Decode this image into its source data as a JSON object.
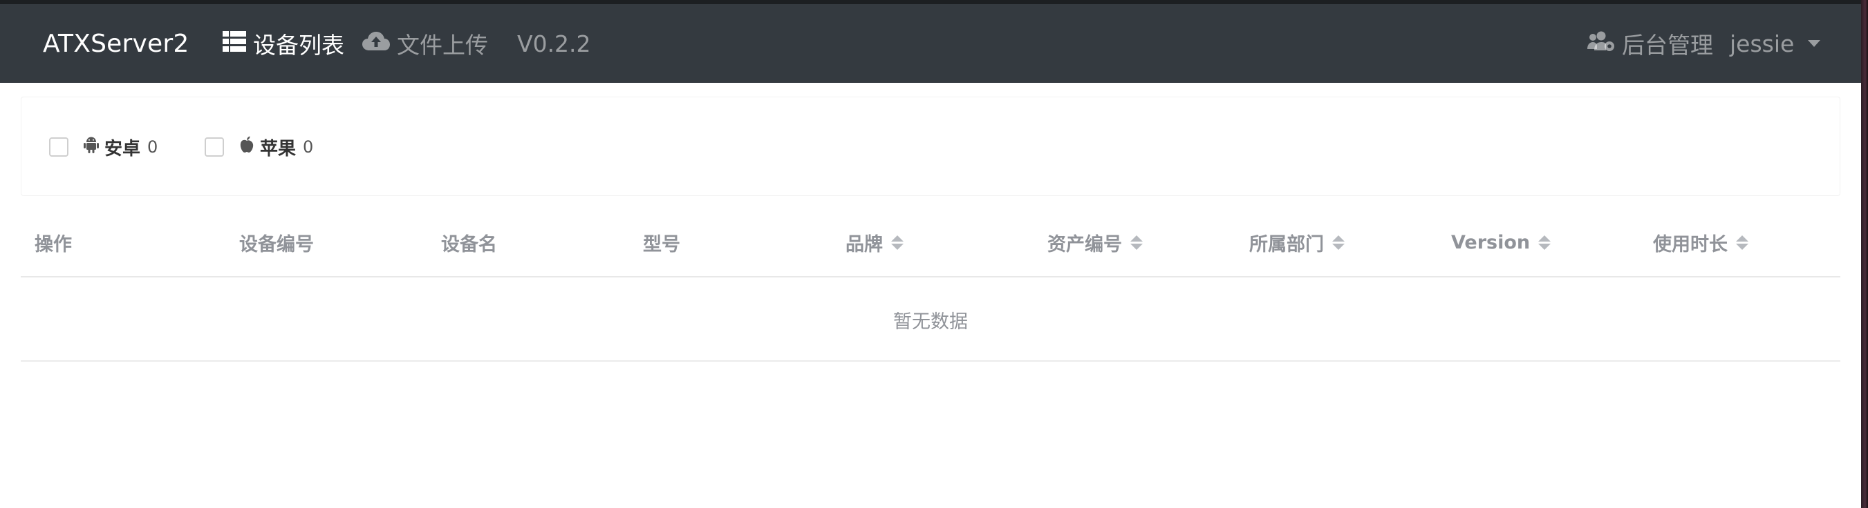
{
  "navbar": {
    "brand": "ATXServer2",
    "device_list": "设备列表",
    "file_upload": "文件上传",
    "version": "V0.2.2",
    "admin": "后台管理",
    "user": "jessie",
    "icons": {
      "device_list": "list-icon",
      "file_upload": "cloud-upload-icon",
      "admin": "users-cog-icon",
      "user_menu": "caret-down-icon"
    }
  },
  "filters": [
    {
      "icon": "android-icon",
      "label": "安卓",
      "count": "0",
      "checked": false
    },
    {
      "icon": "apple-icon",
      "label": "苹果",
      "count": "0",
      "checked": false
    }
  ],
  "table": {
    "columns": [
      {
        "label": "操作",
        "sortable": false
      },
      {
        "label": "设备编号",
        "sortable": false
      },
      {
        "label": "设备名",
        "sortable": false
      },
      {
        "label": "型号",
        "sortable": false
      },
      {
        "label": "品牌",
        "sortable": true
      },
      {
        "label": "资产编号",
        "sortable": true
      },
      {
        "label": "所属部门",
        "sortable": true
      },
      {
        "label": "Version",
        "sortable": true
      },
      {
        "label": "使用时长",
        "sortable": true
      }
    ],
    "empty_text": "暂无数据"
  },
  "colors": {
    "navbar_bg": "#343a40",
    "header_text": "#909399"
  }
}
